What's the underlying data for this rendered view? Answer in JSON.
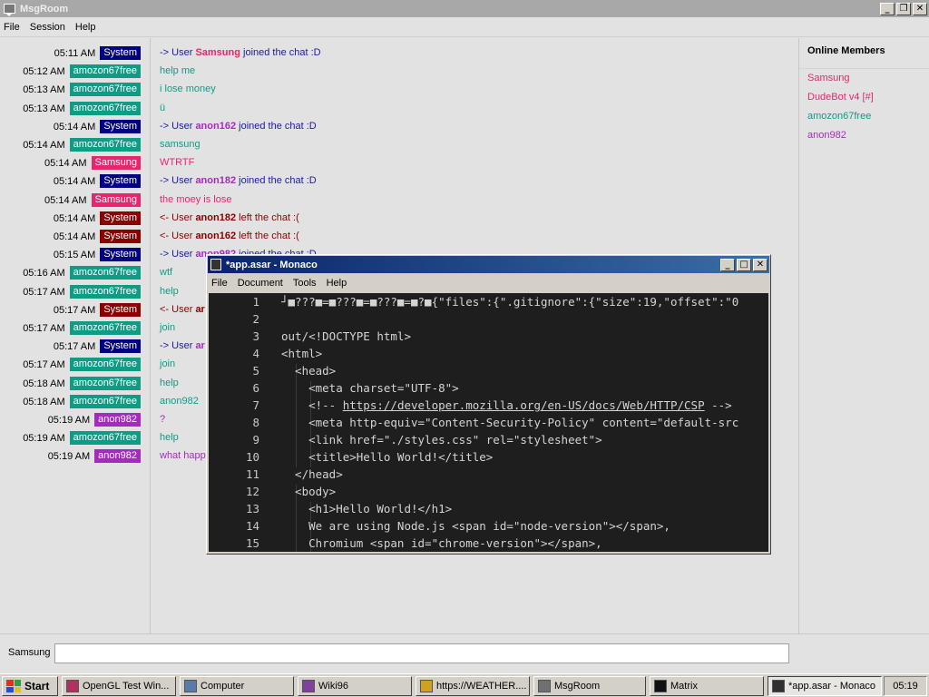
{
  "window": {
    "title": "MsgRoom",
    "menu": [
      "File",
      "Session",
      "Help"
    ],
    "controls": {
      "minimize": "_",
      "maximize": "❐",
      "close": "✕"
    }
  },
  "colors": {
    "System": "#000080",
    "System-left": "#800000",
    "amozon67free": "#0f9c85",
    "Samsung": "#e6266e",
    "anon982": "#a62abf"
  },
  "log": [
    {
      "time": "05:11 AM",
      "user": "System",
      "badge_color": "#000080",
      "text_color": "#1a1aa0",
      "pre": "-> User ",
      "name": "Samsung",
      "name_color": "#e6266e",
      "post": " joined the chat :D"
    },
    {
      "time": "05:12 AM",
      "user": "amozon67free",
      "badge_color": "#0f9c85",
      "text_color": "#0f9c85",
      "pre": "help me",
      "name": "",
      "name_color": "",
      "post": ""
    },
    {
      "time": "05:13 AM",
      "user": "amozon67free",
      "badge_color": "#0f9c85",
      "text_color": "#0f9c85",
      "pre": "i lose money",
      "name": "",
      "name_color": "",
      "post": ""
    },
    {
      "time": "05:13 AM",
      "user": "amozon67free",
      "badge_color": "#0f9c85",
      "text_color": "#0f9c85",
      "pre": "ü",
      "name": "",
      "name_color": "",
      "post": ""
    },
    {
      "time": "05:14 AM",
      "user": "System",
      "badge_color": "#000080",
      "text_color": "#1a1aa0",
      "pre": "-> User ",
      "name": "anon162",
      "name_color": "#a62abf",
      "post": " joined the chat :D"
    },
    {
      "time": "05:14 AM",
      "user": "amozon67free",
      "badge_color": "#0f9c85",
      "text_color": "#0f9c85",
      "pre": "samsung",
      "name": "",
      "name_color": "",
      "post": ""
    },
    {
      "time": "05:14 AM",
      "user": "Samsung",
      "badge_color": "#e6266e",
      "text_color": "#e6266e",
      "pre": "WTRTF",
      "name": "",
      "name_color": "",
      "post": ""
    },
    {
      "time": "05:14 AM",
      "user": "System",
      "badge_color": "#000080",
      "text_color": "#1a1aa0",
      "pre": "-> User ",
      "name": "anon182",
      "name_color": "#a62abf",
      "post": " joined the chat :D"
    },
    {
      "time": "05:14 AM",
      "user": "Samsung",
      "badge_color": "#e6266e",
      "text_color": "#e6266e",
      "pre": "the moey is lose",
      "name": "",
      "name_color": "",
      "post": ""
    },
    {
      "time": "05:14 AM",
      "user": "System",
      "badge_color": "#8b0000",
      "text_color": "#8b0000",
      "pre": "<- User ",
      "name": "anon182",
      "name_color": "#8b0000",
      "post": " left the chat :("
    },
    {
      "time": "05:14 AM",
      "user": "System",
      "badge_color": "#8b0000",
      "text_color": "#8b0000",
      "pre": "<- User ",
      "name": "anon162",
      "name_color": "#8b0000",
      "post": " left the chat :("
    },
    {
      "time": "05:15 AM",
      "user": "System",
      "badge_color": "#000080",
      "text_color": "#1a1aa0",
      "pre": "-> User ",
      "name": "anon982",
      "name_color": "#a62abf",
      "post": " joined the chat :D"
    },
    {
      "time": "05:16 AM",
      "user": "amozon67free",
      "badge_color": "#0f9c85",
      "text_color": "#0f9c85",
      "pre": "wtf",
      "name": "",
      "name_color": "",
      "post": ""
    },
    {
      "time": "05:17 AM",
      "user": "amozon67free",
      "badge_color": "#0f9c85",
      "text_color": "#0f9c85",
      "pre": "help",
      "name": "",
      "name_color": "",
      "post": ""
    },
    {
      "time": "05:17 AM",
      "user": "System",
      "badge_color": "#8b0000",
      "text_color": "#8b0000",
      "pre": "<- User ",
      "name": "ar",
      "name_color": "#8b0000",
      "post": ""
    },
    {
      "time": "05:17 AM",
      "user": "amozon67free",
      "badge_color": "#0f9c85",
      "text_color": "#0f9c85",
      "pre": "join",
      "name": "",
      "name_color": "",
      "post": ""
    },
    {
      "time": "05:17 AM",
      "user": "System",
      "badge_color": "#000080",
      "text_color": "#1a1aa0",
      "pre": "-> User ",
      "name": "ar",
      "name_color": "#a62abf",
      "post": ""
    },
    {
      "time": "05:17 AM",
      "user": "amozon67free",
      "badge_color": "#0f9c85",
      "text_color": "#0f9c85",
      "pre": "join",
      "name": "",
      "name_color": "",
      "post": ""
    },
    {
      "time": "05:18 AM",
      "user": "amozon67free",
      "badge_color": "#0f9c85",
      "text_color": "#0f9c85",
      "pre": "help",
      "name": "",
      "name_color": "",
      "post": ""
    },
    {
      "time": "05:18 AM",
      "user": "amozon67free",
      "badge_color": "#0f9c85",
      "text_color": "#0f9c85",
      "pre": "anon982",
      "name": "",
      "name_color": "",
      "post": ""
    },
    {
      "time": "05:19 AM",
      "user": "anon982",
      "badge_color": "#a62abf",
      "text_color": "#a62abf",
      "pre": "?",
      "name": "",
      "name_color": "",
      "post": ""
    },
    {
      "time": "05:19 AM",
      "user": "amozon67free",
      "badge_color": "#0f9c85",
      "text_color": "#0f9c85",
      "pre": "help",
      "name": "",
      "name_color": "",
      "post": ""
    },
    {
      "time": "05:19 AM",
      "user": "anon982",
      "badge_color": "#a62abf",
      "text_color": "#a62abf",
      "pre": "what happ",
      "name": "",
      "name_color": "",
      "post": ""
    }
  ],
  "members": {
    "title": "Online Members",
    "list": [
      {
        "name": "Samsung",
        "color": "#e6266e"
      },
      {
        "name": "DudeBot v4 [#]",
        "color": "#e6266e"
      },
      {
        "name": "amozon67free",
        "color": "#0f9c85"
      },
      {
        "name": "anon982",
        "color": "#a62abf"
      }
    ]
  },
  "input": {
    "label": "Samsung",
    "value": ""
  },
  "editor": {
    "title": "*app.asar - Monaco",
    "menu": [
      "File",
      "Document",
      "Tools",
      "Help"
    ],
    "lines": [
      {
        "n": "1",
        "text": "┘■???■=■???■=■???■=■?■{\"files\":{\".gitignore\":{\"size\":19,\"offset\":\"0"
      },
      {
        "n": "2",
        "text": ""
      },
      {
        "n": "3",
        "text": "out/<!DOCTYPE html>"
      },
      {
        "n": "4",
        "text": "<html>"
      },
      {
        "n": "5",
        "text": "  <head>"
      },
      {
        "n": "6",
        "text": "    <meta charset=\"UTF-8\">"
      },
      {
        "n": "7",
        "text": "    <!-- https://developer.mozilla.org/en-US/docs/Web/HTTP/CSP -->"
      },
      {
        "n": "8",
        "text": "    <meta http-equiv=\"Content-Security-Policy\" content=\"default-src"
      },
      {
        "n": "9",
        "text": "    <link href=\"./styles.css\" rel=\"stylesheet\">"
      },
      {
        "n": "10",
        "text": "    <title>Hello World!</title>"
      },
      {
        "n": "11",
        "text": "  </head>"
      },
      {
        "n": "12",
        "text": "  <body>"
      },
      {
        "n": "13",
        "text": "    <h1>Hello World!</h1>"
      },
      {
        "n": "14",
        "text": "    We are using Node.js <span id=\"node-version\"></span>,"
      },
      {
        "n": "15",
        "text": "    Chromium <span id=\"chrome-version\"></span>,"
      }
    ]
  },
  "taskbar": {
    "start": "Start",
    "items": [
      {
        "label": "OpenGL Test Win...",
        "active": false,
        "icon_color": "#b03060"
      },
      {
        "label": "Computer",
        "active": false,
        "icon_color": "#5a7aa8"
      },
      {
        "label": "Wiki96",
        "active": false,
        "icon_color": "#8040a0"
      },
      {
        "label": "https://WEATHER....",
        "active": false,
        "icon_color": "#d0a020"
      },
      {
        "label": "MsgRoom",
        "active": false,
        "icon_color": "#707070"
      },
      {
        "label": "Matrix",
        "active": false,
        "icon_color": "#101010"
      },
      {
        "label": "*app.asar - Monaco",
        "active": true,
        "icon_color": "#303030"
      }
    ],
    "clock": "05:19"
  }
}
